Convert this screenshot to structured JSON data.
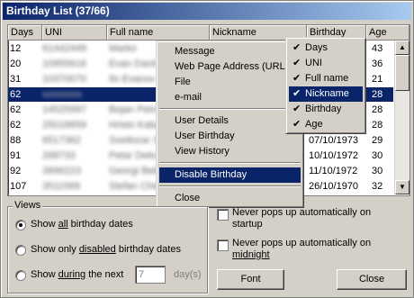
{
  "window": {
    "title": "Birthday List (37/66)"
  },
  "columns": [
    "Days",
    "UNI",
    "Full name",
    "Nickname",
    "Birthday",
    "Age"
  ],
  "rows": [
    {
      "days": "12",
      "uni": "61442449",
      "full": "Marko",
      "nick": "",
      "birthday": "",
      "age": "43"
    },
    {
      "days": "20",
      "uni": "10955616",
      "full": "Evan Danil",
      "nick": "",
      "birthday": "",
      "age": "36"
    },
    {
      "days": "31",
      "uni": "10370070",
      "full": "Ilo Evanov",
      "nick": "",
      "birthday": "",
      "age": "21"
    },
    {
      "days": "62",
      "uni": "xxxxxxxx",
      "full": "",
      "nick": "",
      "birthday": "",
      "age": "28",
      "selected": true
    },
    {
      "days": "62",
      "uni": "14525997",
      "full": "Bojan Petrov",
      "nick": "",
      "birthday": "",
      "age": "28"
    },
    {
      "days": "62",
      "uni": "25018659",
      "full": "Hristo Kabak",
      "nick": "",
      "birthday": "",
      "age": "28"
    },
    {
      "days": "88",
      "uni": "6517362",
      "full": "Svetlozar Sto",
      "nick": "",
      "birthday": "07/10/1973",
      "age": "29"
    },
    {
      "days": "91",
      "uni": "268733",
      "full": "Petar Dekov",
      "nick": "",
      "birthday": "10/10/1972",
      "age": "30"
    },
    {
      "days": "92",
      "uni": "3696223",
      "full": "Georgi Bekov",
      "nick": "",
      "birthday": "11/10/1972",
      "age": "30"
    },
    {
      "days": "107",
      "uni": "3511569",
      "full": "Stefan Chekov",
      "nick": "",
      "birthday": "26/10/1970",
      "age": "32"
    }
  ],
  "context_menu": {
    "items": [
      "Message",
      "Web Page Address (URL)",
      "File",
      "e-mail",
      "User Details",
      "User Birthday",
      "View History",
      "Disable Birthday",
      "Close"
    ],
    "highlighted": "Disable Birthday"
  },
  "column_menu": {
    "items": [
      "Days",
      "UNI",
      "Full name",
      "Nickname",
      "Birthday",
      "Age"
    ],
    "highlighted": "Nickname"
  },
  "views": {
    "label": "Views",
    "opt_all_pre": "Show ",
    "opt_all_u": "all",
    "opt_all_post": " birthday dates",
    "opt_disabled_pre": "Show only ",
    "opt_disabled_u": "disabled",
    "opt_disabled_post": " birthday dates",
    "opt_next_pre": "Show ",
    "opt_next_u": "during",
    "opt_next_post": " the next",
    "next_value": "7",
    "days_label": "day(s)"
  },
  "options": {
    "startup": "Never pops up automatically on startup",
    "midnight_pre": "Never pops up automatically on ",
    "midnight_u": "midnight"
  },
  "buttons": {
    "font": "Font",
    "close": "Close"
  }
}
